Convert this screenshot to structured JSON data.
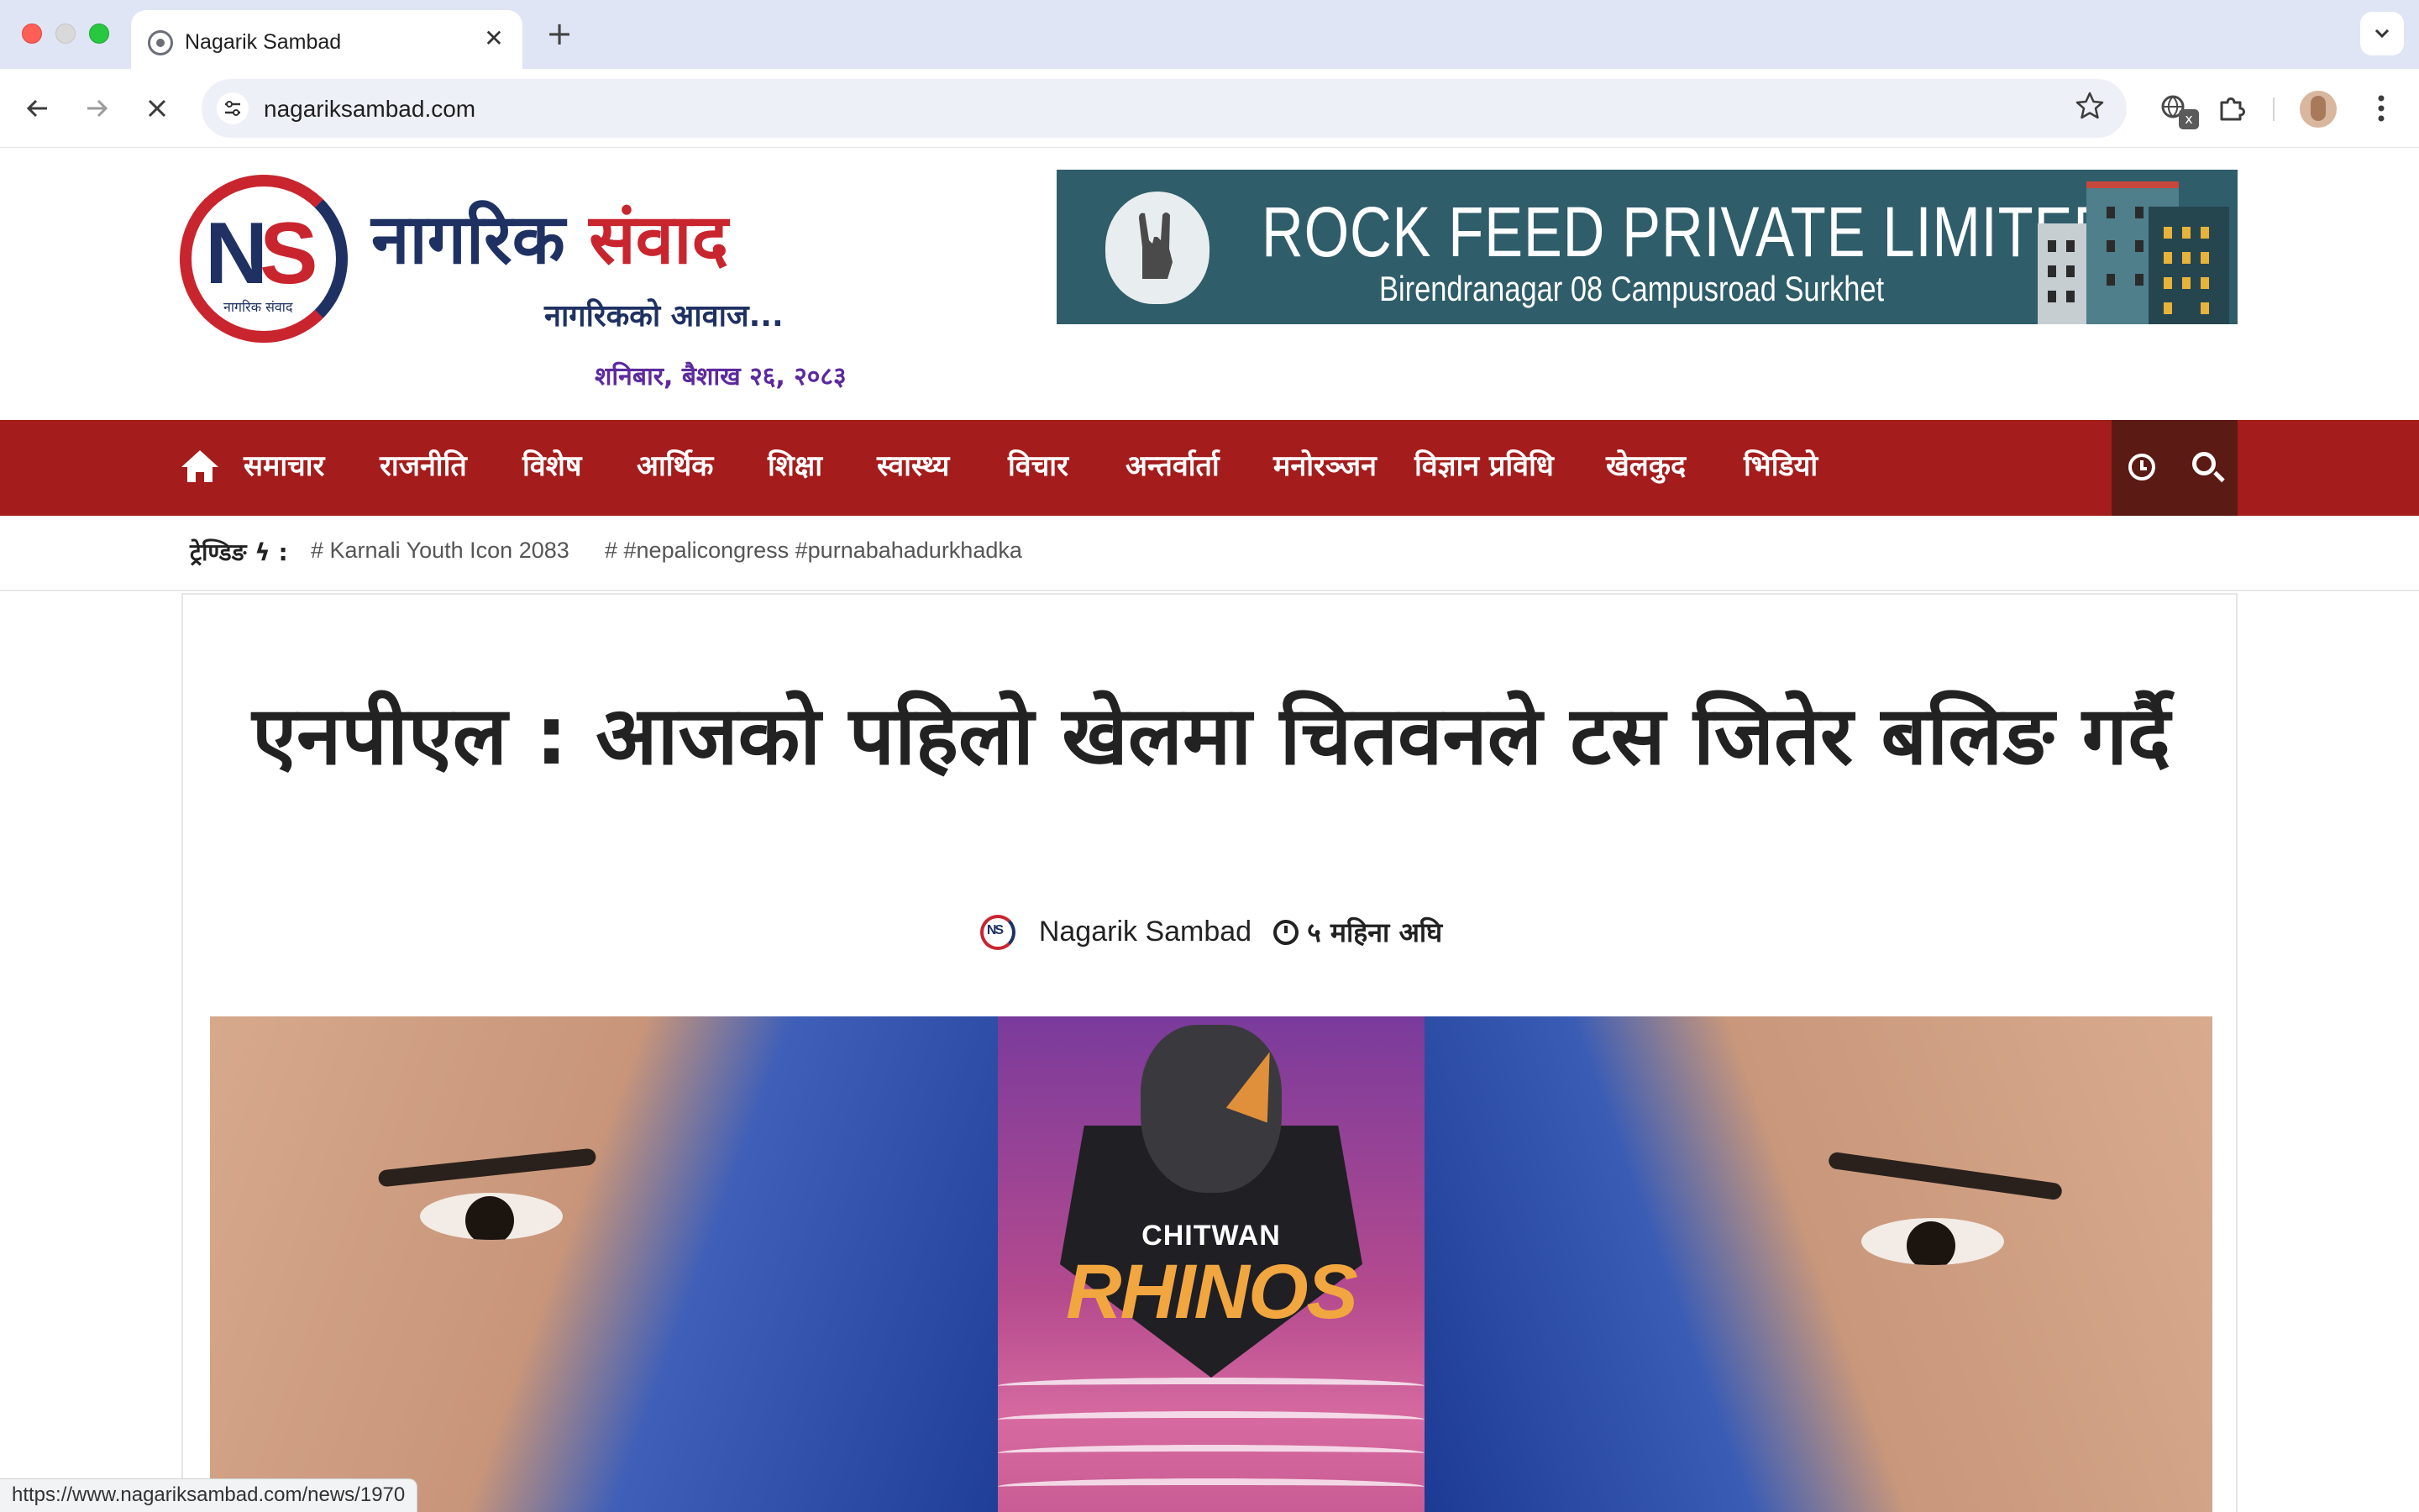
{
  "browser": {
    "tab_title": "Nagarik Sambad",
    "tab_close": "✕",
    "new_tab": "+",
    "url": "nagariksambad.com",
    "status_url": "https://www.nagariksambad.com/news/1970",
    "icons": {
      "back": "arrow-left-icon",
      "forward": "arrow-right-icon",
      "stop": "close-icon",
      "site_info": "tune-icon",
      "bookmark": "star-icon",
      "extension": "extension-icon",
      "profile": "avatar",
      "menu": "kebab-menu-icon"
    }
  },
  "header": {
    "logo_letters": "NS",
    "logo_sub": "नागरिक संवाद",
    "brand_part1": "नागरिक",
    "brand_part2": "संवाद",
    "tagline": "नागरिकको आवाज...",
    "date": "शनिबार, बैशाख २६, २०८३",
    "colors": {
      "navy": "#1f3163",
      "red": "#c9252f",
      "date_purple": "#5c2a9d"
    }
  },
  "ad": {
    "title": "ROCK FEED PRIVATE LIMITED",
    "subtitle": "Birendranagar 08 Campusroad Surkhet",
    "background": "#2f5d6a"
  },
  "nav": {
    "items": [
      "समाचार",
      "राजनीति",
      "विशेष",
      "आर्थिक",
      "शिक्षा",
      "स्वास्थ्य",
      "विचार",
      "अन्तर्वार्ता",
      "मनोरञ्जन",
      "विज्ञान प्रविधि",
      "खेलकुद",
      "भिडियो"
    ],
    "background": "#a51c1c",
    "tools_background": "#5b1a14"
  },
  "trending": {
    "label": "ट्रेण्डिङ ϟ :",
    "tags": [
      "# Karnali Youth Icon 2083",
      "# #nepalicongress #purnabahadurkhadka"
    ]
  },
  "article": {
    "headline": "एनपीएल : आजको पहिलो खेलमा चितवनले टस जितेर बलिङ गर्दै",
    "author": "Nagarik Sambad",
    "time_ago": "५ महिना अघि",
    "hero_team_top": "CHITWAN",
    "hero_team_bottom": "RHINOS"
  }
}
